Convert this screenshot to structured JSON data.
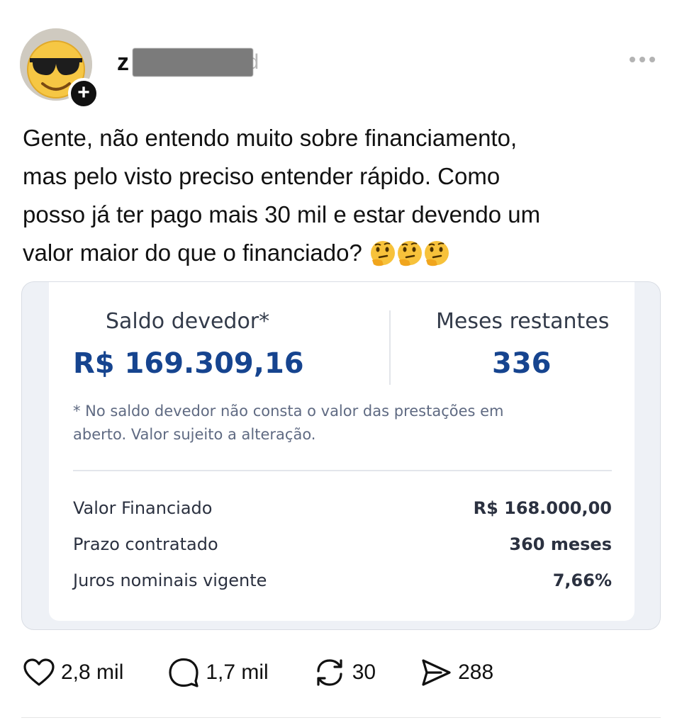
{
  "post": {
    "author": {
      "username_start": "z",
      "username_end": "d",
      "avatar_icon": "sunglasses-emoji-icon"
    },
    "text_lines": [
      "Gente, não entendo muito sobre financiamento,",
      "mas pelo visto preciso entender rápido. Como",
      "posso já ter pago mais 30 mil e estar devendo um",
      "valor maior do que o financiado?"
    ],
    "emoji_icons": [
      "thinking-face-icon",
      "thinking-face-icon",
      "thinking-face-icon"
    ]
  },
  "card": {
    "saldo_label": "Saldo devedor*",
    "saldo_value": "R$ 169.309,16",
    "meses_label": "Meses restantes",
    "meses_value": "336",
    "footnote_line1": "* No saldo devedor não consta o valor das prestações em",
    "footnote_line2": "aberto. Valor sujeito a alteração.",
    "rows": [
      {
        "label": "Valor Financiado",
        "value": "R$ 168.000,00"
      },
      {
        "label": "Prazo contratado",
        "value": "360 meses"
      },
      {
        "label": "Juros nominais vigente",
        "value": "7,66%"
      }
    ],
    "accent_color": "#16448f"
  },
  "actions": {
    "likes": "2,8 mil",
    "replies": "1,7 mil",
    "reposts": "30",
    "shares": "288"
  }
}
